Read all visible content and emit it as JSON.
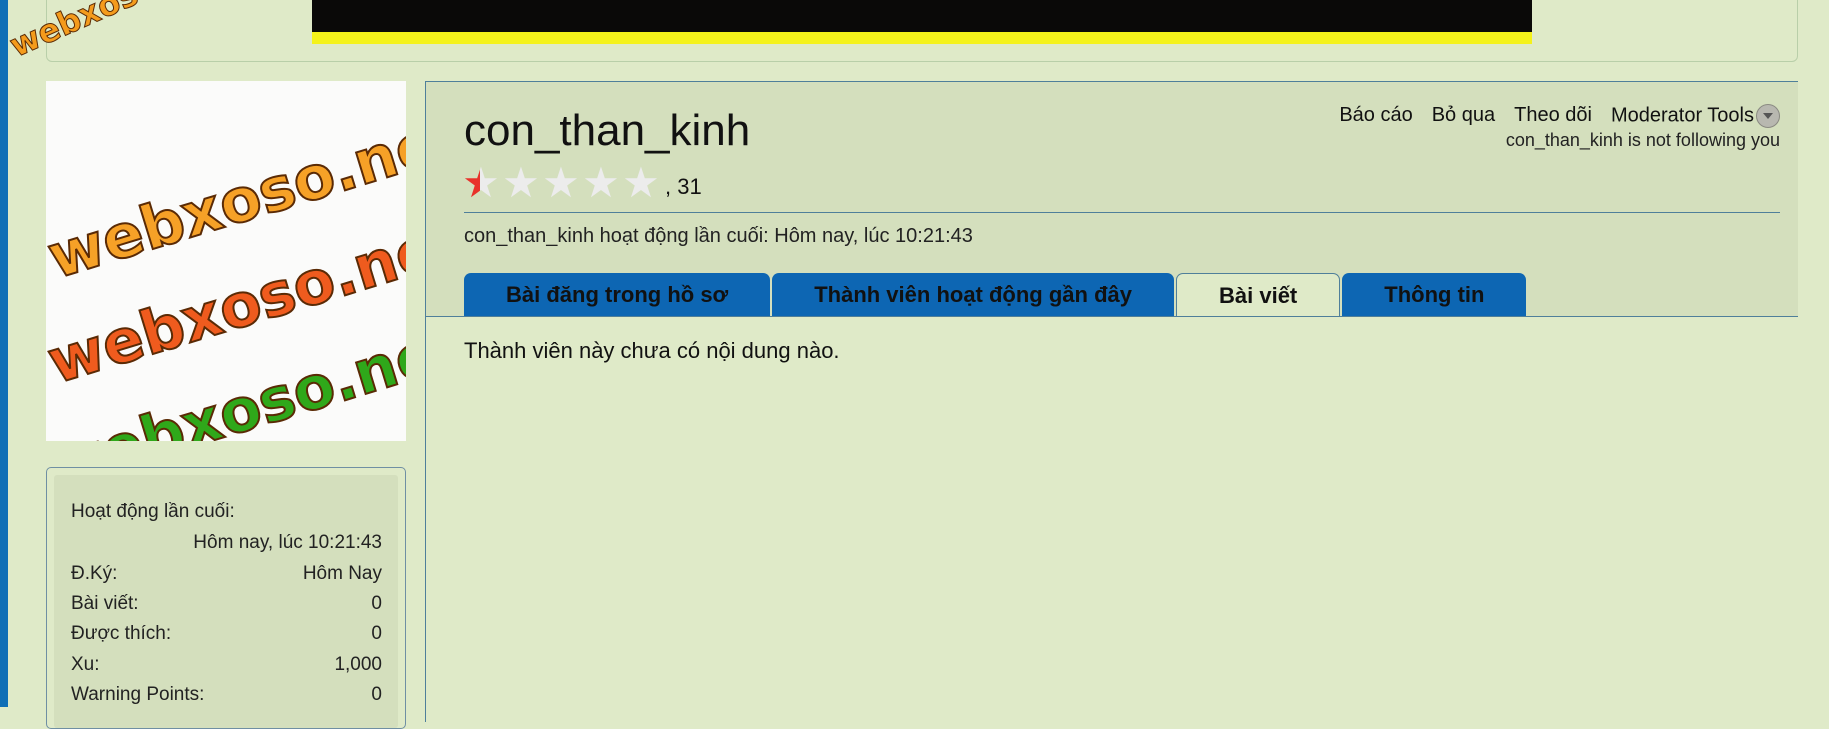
{
  "watermark_text": "webxoso.net",
  "profile": {
    "username": "con_than_kinh",
    "points_count": ", 31",
    "rating_fraction": 0.1,
    "last_active_line": "con_than_kinh hoạt động lần cuối: Hôm nay, lúc 10:21:43",
    "follow_status": "con_than_kinh is not following you"
  },
  "actions": {
    "report": "Báo cáo",
    "ignore": "Bỏ qua",
    "follow": "Theo dõi",
    "moderator_tools": "Moderator Tools"
  },
  "tabs": [
    {
      "label": "Bài đăng trong hồ sơ",
      "active": false
    },
    {
      "label": "Thành viên hoạt động gần đây",
      "active": false
    },
    {
      "label": "Bài viết",
      "active": true
    },
    {
      "label": "Thông tin",
      "active": false
    }
  ],
  "content": {
    "empty_message": "Thành viên này chưa có nội dung nào."
  },
  "info": {
    "last_active_label": "Hoạt động lần cuối:",
    "last_active_value": "Hôm nay, lúc 10:21:43",
    "rows": [
      {
        "label": "Đ.Ký:",
        "value": "Hôm Nay"
      },
      {
        "label": "Bài viết:",
        "value": "0"
      },
      {
        "label": "Được thích:",
        "value": "0"
      },
      {
        "label": "Xu:",
        "value": "1,000"
      },
      {
        "label": "Warning Points:",
        "value": "0"
      }
    ]
  },
  "colors": {
    "page_bg": "#dfeac8",
    "tab_blue": "#0d66b3",
    "accent_bar": "#0f6fb6"
  }
}
